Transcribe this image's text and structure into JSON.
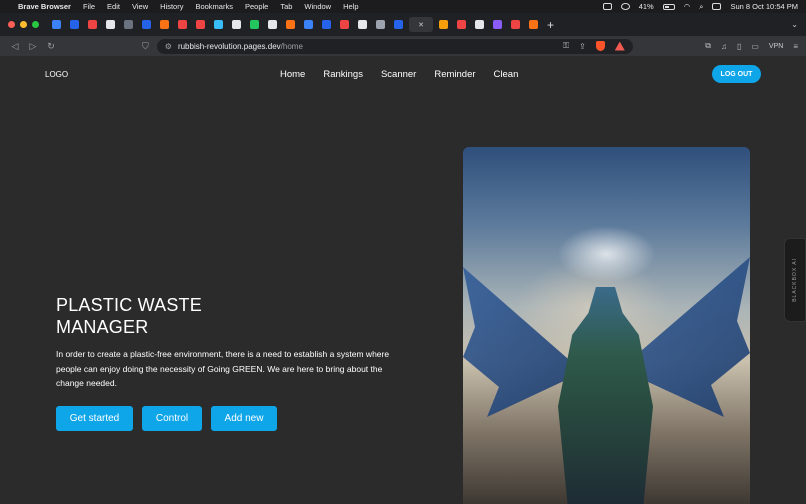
{
  "menubar": {
    "app_name": "Brave Browser",
    "items": [
      "File",
      "Edit",
      "View",
      "History",
      "Bookmarks",
      "People",
      "Tab",
      "Window",
      "Help"
    ],
    "battery": "41%",
    "datetime": "Sun 8 Oct  10:54 PM"
  },
  "browser": {
    "url_host": "rubbish-revolution.pages.dev",
    "url_path": "/home",
    "vpn_label": "VPN",
    "tab_favicon_colors": [
      "#3b82f6",
      "#2563eb",
      "#ef4444",
      "#e5e7eb",
      "#6b7280",
      "#2563eb",
      "#f97316",
      "#ef4444",
      "#ef4444",
      "#38bdf8",
      "#e5e7eb",
      "#22c55e",
      "#e5e7eb",
      "#f97316",
      "#3b82f6",
      "#2563eb",
      "#ef4444",
      "#e5e7eb",
      "#9ca3af",
      "#2563eb",
      "#f59e0b",
      "#ef4444",
      "#e5e7eb",
      "#8b5cf6",
      "#ef4444",
      "#f97316"
    ]
  },
  "site": {
    "logo": "LOGO",
    "nav": [
      "Home",
      "Rankings",
      "Scanner",
      "Reminder",
      "Clean"
    ],
    "logout": "LOG OUT",
    "hero_title": "PLASTIC WASTE MANAGER",
    "hero_description": "In order to create a plastic-free environment, there is a need to establish a system where people can enjoy doing the necessity of Going GREEN. We are here to bring about the change needed.",
    "buttons": {
      "get_started": "Get started",
      "control": "Control",
      "add_new": "Add new"
    },
    "accent_color": "#0ea5e9",
    "background_color": "#2b2b2b"
  },
  "sidebar_widget": {
    "label": "BLACKBOX AI"
  }
}
